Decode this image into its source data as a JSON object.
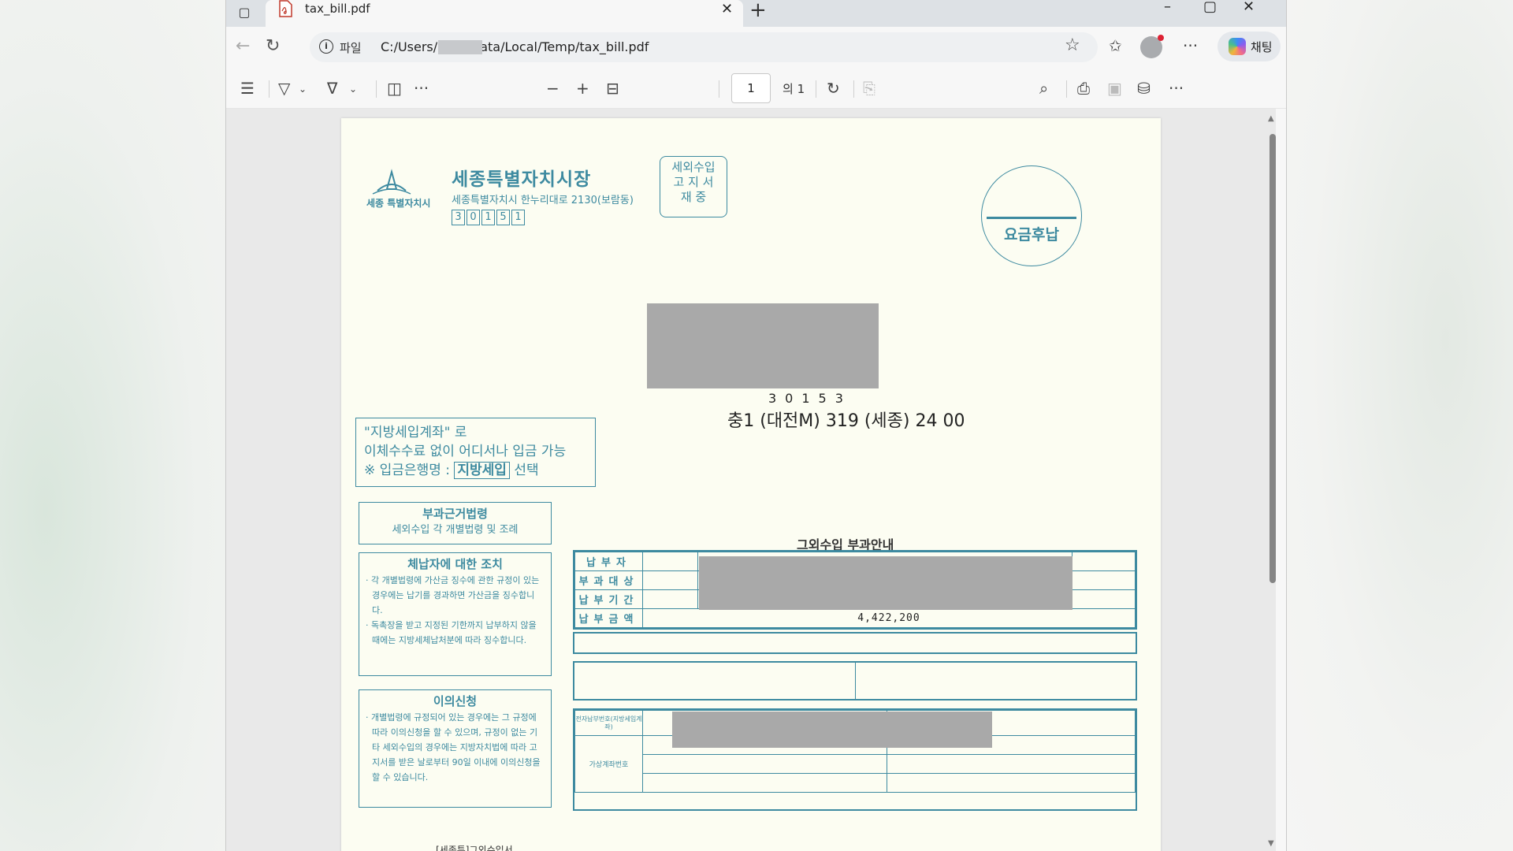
{
  "browser": {
    "tab_title": "tax_bill.pdf",
    "url_scheme": "파일",
    "url": "C:/Users/        /AppData/Local/Temp/tax_bill.pdf",
    "copilot_label": "채팅"
  },
  "pdf_toolbar": {
    "page_number": "1",
    "page_count": "의 1"
  },
  "document": {
    "city_name": "세종특별자치시장",
    "city_logo_text": "세종 특별자치시",
    "city_address": "세종특별자치시 한누리대로 2130(보람동)",
    "city_zip_digits": [
      "3",
      "0",
      "1",
      "5",
      "1"
    ],
    "doc_type_lines": [
      "세외수입",
      "고 지 서",
      "재 중"
    ],
    "stamp_text": "요금후납",
    "recipient_zip": "30153",
    "recipient_route": "충1 (대전M) 319 (세종) 24 00",
    "notice_line1": "\"지방세입계좌\" 로",
    "notice_line2": "이체수수료 없이 어디서나 입금 가능",
    "notice_line3_prefix": "※ 입금은행명 :",
    "notice_bank": "지방세입",
    "notice_line3_suffix": "선택",
    "legal_basis_title": "부과근거법령",
    "legal_basis_body": "세외수입 각 개별법령 및 조례",
    "delinquent_title": "체납자에 대한 조치",
    "delinquent_items": [
      "각 개별법령에 가산금 징수에 관한 규정이 있는 경우에는 납기를 경과하면 가산금을 징수합니다.",
      "독촉장을 받고 지정된 기한까지 납부하지 않을 때에는 지방세체납처분에 따라 징수합니다."
    ],
    "objection_title": "이의신청",
    "objection_items": [
      "개별법령에 규정되어 있는 경우에는 그 규정에 따라 이의신청을 할 수 있으며, 규정이 없는 기타 세외수입의 경우에는 지방자치법에 따라 고지서를 받은 날로부터 90일 이내에 이의신청을 할 수 있습니다."
    ],
    "section_title": "그외수입 부과안내",
    "table_labels": [
      "납부자",
      "부과대상",
      "납부기간",
      "납부금액"
    ],
    "payment_amount": "4,422,200",
    "eacct_label": "전자납부번호(지방세입계좌)",
    "vacct_label": "가상계좌번호",
    "cutoff_text": "[세종특]그외수입서"
  },
  "colors": {
    "form_ink": "#3d8aa0",
    "page_paper": "#fcfdf2",
    "redaction": "#a9a9a9"
  }
}
